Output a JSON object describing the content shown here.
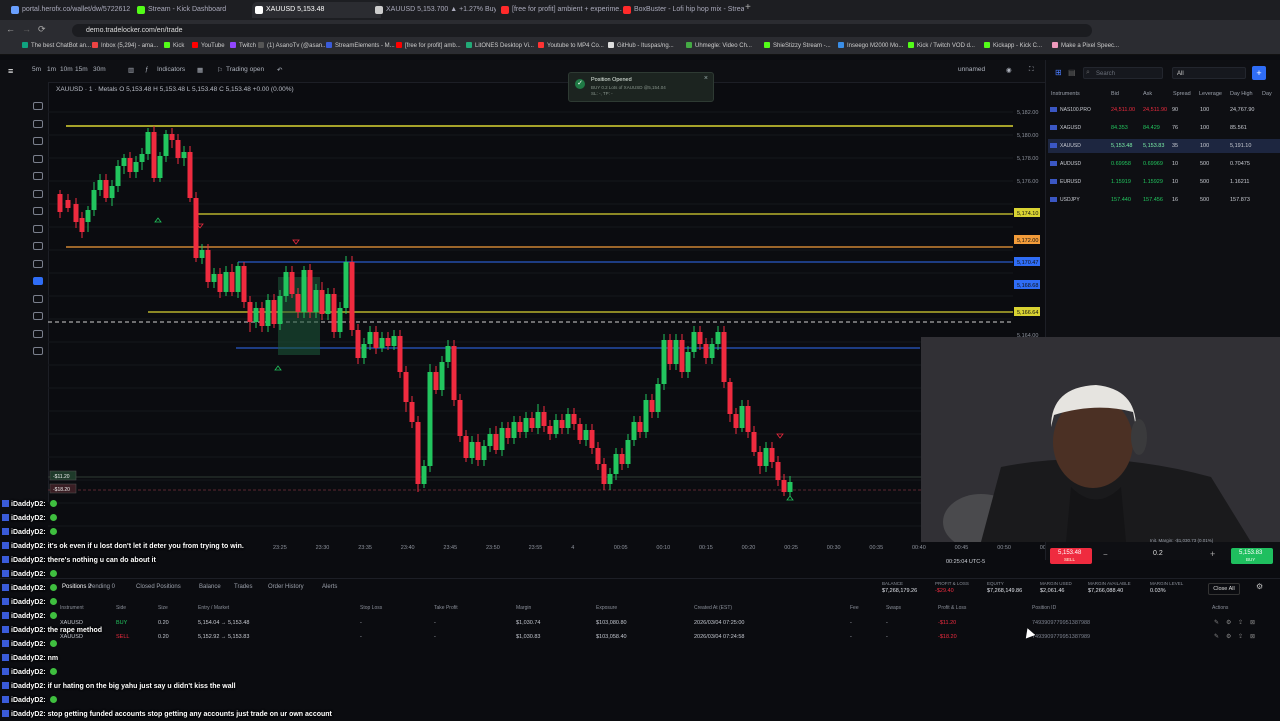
{
  "browser": {
    "tabs": [
      {
        "label": "portal.herofx.co/wallet/dw/5722612",
        "color": "#6aa0ff"
      },
      {
        "label": "Stream - Kick Dashboard",
        "color": "#53fc18"
      },
      {
        "label": "XAUUSD 5,153.48",
        "color": "#ffffff",
        "active": true
      },
      {
        "label": "XAUUSD 5,153.700 ▲ +1.27% BuySel...",
        "color": "#cccccc"
      },
      {
        "label": "[free for profit] ambient + experime...",
        "color": "#ff2a2a"
      },
      {
        "label": "BoxBuster - Lofi hip hop mix - Strea...",
        "color": "#ff2a2a"
      }
    ],
    "url": "demo.tradelocker.com/en/trade",
    "bookmarks": [
      "The best ChatBot an...",
      "Inbox (5,294) - ama...",
      "Kick",
      "YouTube",
      "Twitch",
      "(1) AsanoTv (@asan...",
      "StreamElements - M...",
      "[free for profit] amb...",
      "LitONES Desktop Vi...",
      "Youtube to MP4 Co...",
      "GitHub - Ituspas/ng...",
      "Uhmegle: Video Ch...",
      "ShieStizzy Stream -...",
      "Inseego M2000 Mo...",
      "Kick / Twitch VOD d...",
      "Kickapp - Kick C...",
      "Make a Pixel Speec..."
    ]
  },
  "toolbar": {
    "timeframes": [
      "5m",
      "1m",
      "10m",
      "15m",
      "30m"
    ],
    "indicators": "Indicators",
    "trading": "Trading open",
    "layout": "unnamed"
  },
  "chart": {
    "symbol_line": "XAUUSD · 1 · Metals  O 5,153.48  H 5,153.48  L 5,153.48  C 5,153.48  +0.00 (0.00%)",
    "toast_title": "Position Opened",
    "toast_body": "BUY 0.2 Lots of XAUUSD @5,154.04",
    "toast_body2": "SL: -, TP: -",
    "price_labels": [
      "5,182.00",
      "5,180.00",
      "5,178.00",
      "5,176.00",
      "5,174.10",
      "5,172.00",
      "5,170.47",
      "5,168.68",
      "5,166.64",
      "5,164.00",
      "5,162.00",
      "5,160.00",
      "5,158.00",
      "5,156.00",
      "5,154.00",
      "5,152.00",
      "5,150.00",
      "5,148.00",
      "5,146.00"
    ],
    "time_labels": [
      "23:25",
      "23:30",
      "23:35",
      "23:40",
      "23:45",
      "23:50",
      "23:55",
      "4",
      "00:05",
      "00:10",
      "00:15",
      "00:20",
      "00:25",
      "00:30",
      "00:35",
      "00:40",
      "00:45",
      "00:50",
      "00:55"
    ],
    "clock": "00:25:04 UTC-5",
    "pos_tags": [
      "-$11.20",
      "-$18.20"
    ]
  },
  "instruments": {
    "search_placeholder": "Search",
    "filter": "All",
    "title": "Instruments",
    "headers": [
      "Bid",
      "Ask",
      "Spread",
      "Leverage",
      "Day High",
      "Day"
    ],
    "rows": [
      {
        "name": "NAS100.PRO",
        "bid": "24,511.00",
        "ask": "24,511.90",
        "spread": "90",
        "lev": "100",
        "high": "24,767.90"
      },
      {
        "name": "XAGUSD",
        "bid": "84.353",
        "ask": "84.429",
        "spread": "76",
        "lev": "100",
        "high": "85.561"
      },
      {
        "name": "XAUUSD",
        "bid": "5,153.48",
        "ask": "5,153.83",
        "spread": "35",
        "lev": "100",
        "high": "5,191.10",
        "selected": true
      },
      {
        "name": "AUDUSD",
        "bid": "0.69958",
        "ask": "0.69969",
        "spread": "10",
        "lev": "500",
        "high": "0.70475"
      },
      {
        "name": "EURUSD",
        "bid": "1.15919",
        "ask": "1.15929",
        "spread": "10",
        "lev": "500",
        "high": "1.16211"
      },
      {
        "name": "USDJPY",
        "bid": "157.440",
        "ask": "157.456",
        "spread": "16",
        "lev": "500",
        "high": "157.873"
      }
    ]
  },
  "order": {
    "sell_price": "5,153.48",
    "sell_label": "SELL",
    "qty": "0.2",
    "buy_price": "5,153.83",
    "buy_label": "BUY",
    "margin_note": "Init. Margin: -$1,030.73 (0.01%)"
  },
  "account": {
    "tabs": [
      "Positions 2",
      "Pending 0",
      "Closed Positions",
      "Balance",
      "Trades",
      "Order History",
      "Alerts"
    ],
    "summary": [
      {
        "label": "BALANCE",
        "value": "$7,268,179.26"
      },
      {
        "label": "PROFIT & LOSS",
        "value": "-$29.40"
      },
      {
        "label": "EQUITY",
        "value": "$7,268,149.86"
      },
      {
        "label": "MARGIN USED",
        "value": "$2,061.46"
      },
      {
        "label": "MARGIN AVAILABLE",
        "value": "$7,266,088.40"
      },
      {
        "label": "MARGIN LEVEL",
        "value": "0.03%"
      }
    ],
    "close_all": "Close All",
    "columns": [
      "Instrument",
      "Side",
      "Size",
      "Entry / Market",
      "Stop Loss",
      "Take Profit",
      "Margin",
      "Exposure",
      "Created At (EST)",
      "Fee",
      "Swaps",
      "Profit & Loss",
      "Position ID",
      "Actions"
    ],
    "rows": [
      {
        "inst": "XAUUSD",
        "side": "BUY",
        "size": "0.20",
        "entry": "5,154.04 → 5,153.48",
        "sl": "-",
        "tp": "-",
        "margin": "$1,030.74",
        "exposure": "$103,080.80",
        "created": "2026/03/04 07:25:00",
        "fee": "-",
        "swaps": "-",
        "pnl": "-$11.20",
        "id": "7493909779951387988"
      },
      {
        "inst": "XAUUSD",
        "side": "SELL",
        "size": "0.20",
        "entry": "5,152.92 → 5,153.83",
        "sl": "-",
        "tp": "-",
        "margin": "$1,030.83",
        "exposure": "$103,058.40",
        "created": "2026/03/04 07:24:58",
        "fee": "-",
        "swaps": "-",
        "pnl": "-$18.20",
        "id": "7493909779951387989"
      }
    ]
  },
  "chat": [
    {
      "user": "iDaddyD2",
      "msg": ""
    },
    {
      "user": "iDaddyD2",
      "msg": ""
    },
    {
      "user": "iDaddyD2",
      "msg": ""
    },
    {
      "user": "iDaddyD2",
      "msg": "it's ok even if u lost don't let it deter you from trying to win."
    },
    {
      "user": "iDaddyD2",
      "msg": "there's nothing u can do about it"
    },
    {
      "user": "iDaddyD2",
      "msg": ""
    },
    {
      "user": "iDaddyD2",
      "msg": ""
    },
    {
      "user": "iDaddyD2",
      "msg": ""
    },
    {
      "user": "iDaddyD2",
      "msg": ""
    },
    {
      "user": "iDaddyD2",
      "msg": "the rape method"
    },
    {
      "user": "iDaddyD2",
      "msg": ""
    },
    {
      "user": "iDaddyD2",
      "msg": "nm"
    },
    {
      "user": "iDaddyD2",
      "msg": ""
    },
    {
      "user": "iDaddyD2",
      "msg": "if ur hating on the big yahu just say u didn't kiss the wall"
    },
    {
      "user": "iDaddyD2",
      "msg": ""
    },
    {
      "user": "iDaddyD2",
      "msg": "stop getting funded accounts stop getting any accounts just trade on ur own account"
    }
  ],
  "colors": {
    "bull": "#22c55e",
    "bear": "#ef2b3f",
    "yellow": "#d9d332",
    "orange": "#f39c3a",
    "blue": "#2f6df6"
  }
}
